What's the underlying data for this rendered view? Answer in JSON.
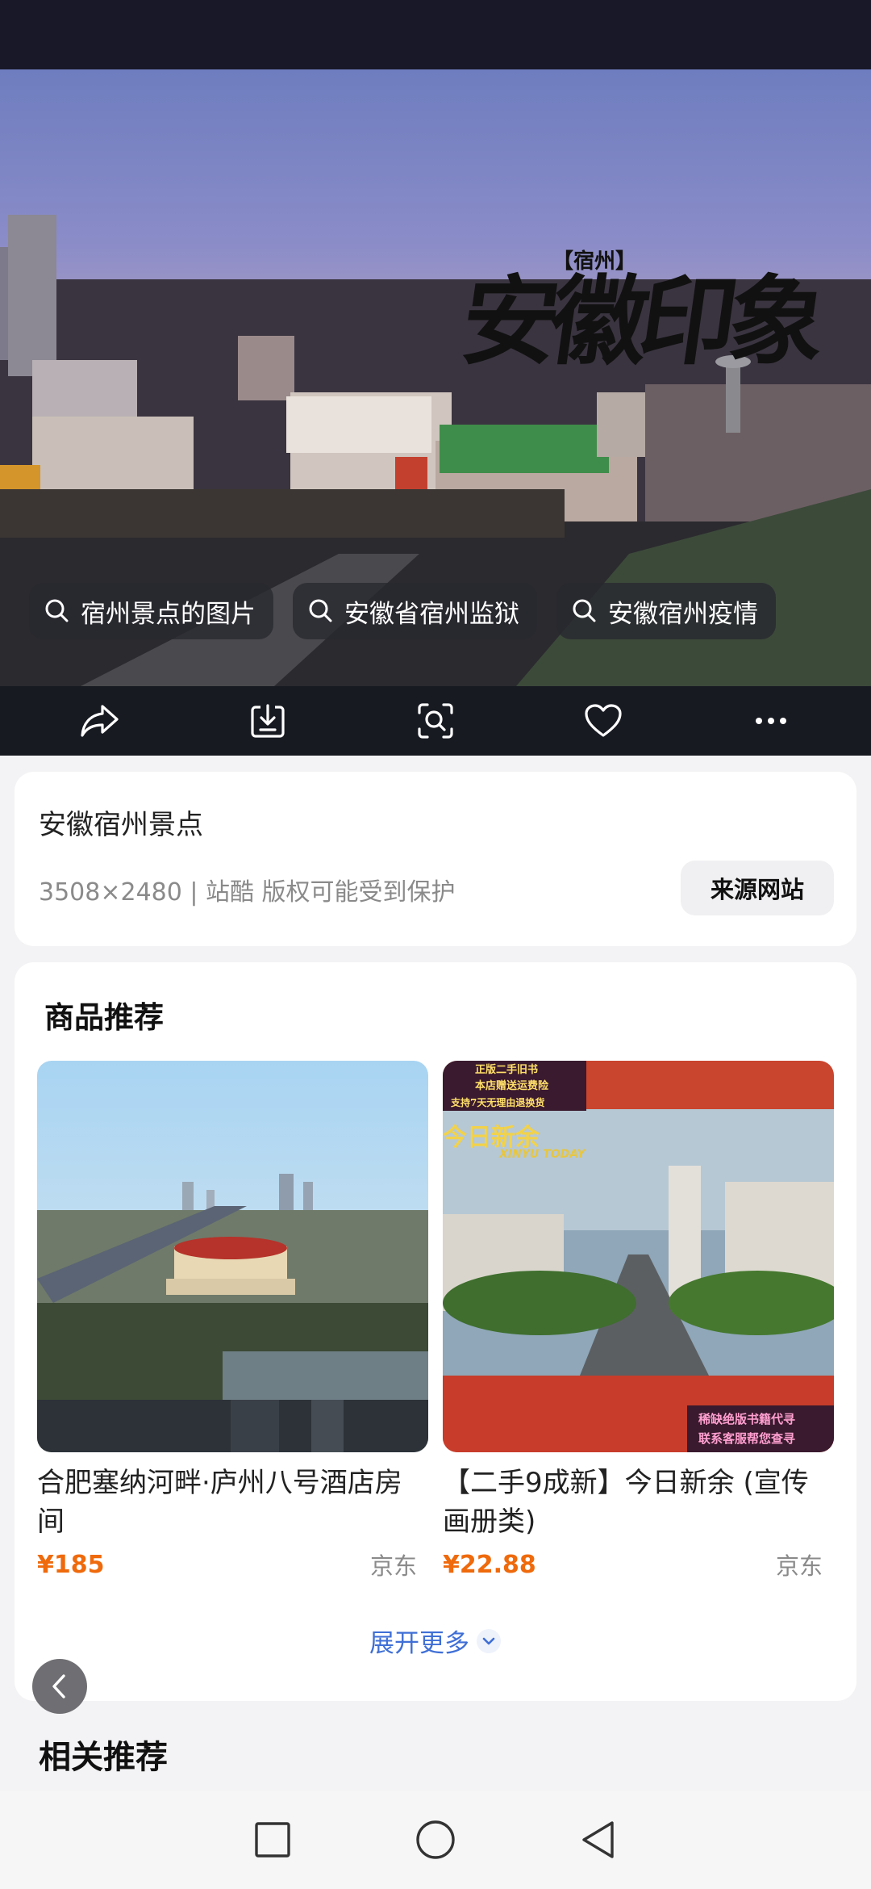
{
  "hero": {
    "title_main": "安徽印象",
    "title_sub": "【宿州】",
    "chips": [
      {
        "label": "宿州景点的图片"
      },
      {
        "label": "安徽省宿州监狱"
      },
      {
        "label": "安徽宿州疫情"
      }
    ]
  },
  "actions": [
    {
      "icon": "share-icon"
    },
    {
      "icon": "download-icon"
    },
    {
      "icon": "visual-search-icon"
    },
    {
      "icon": "favorite-icon"
    },
    {
      "icon": "more-icon"
    }
  ],
  "info": {
    "title": "安徽宿州景点",
    "meta": "3508×2480 | 站酷 版权可能受到保护",
    "source_button": "来源网站"
  },
  "products": {
    "section_title": "商品推荐",
    "items": [
      {
        "name": "合肥塞纳河畔·庐州八号酒店房间",
        "price": "¥185",
        "shop": "京东"
      },
      {
        "name": "【二手9成新】今日新余 (宣传画册类)",
        "price": "¥22.88",
        "shop": "京东"
      }
    ],
    "item2_badges": {
      "top": [
        "正版二手旧书",
        "本店赠送运费险",
        "支持7天无理由退换货"
      ],
      "banner": "今日新余",
      "banner_en": "XINYU TODAY",
      "bottom": [
        "稀缺绝版书籍代寻",
        "联系客服帮您查寻"
      ]
    },
    "expand_label": "展开更多"
  },
  "related": {
    "title": "相关推荐"
  },
  "colors": {
    "accent": "#3f6fd6",
    "price": "#ef6a0c",
    "dark_bar": "#181a22"
  }
}
